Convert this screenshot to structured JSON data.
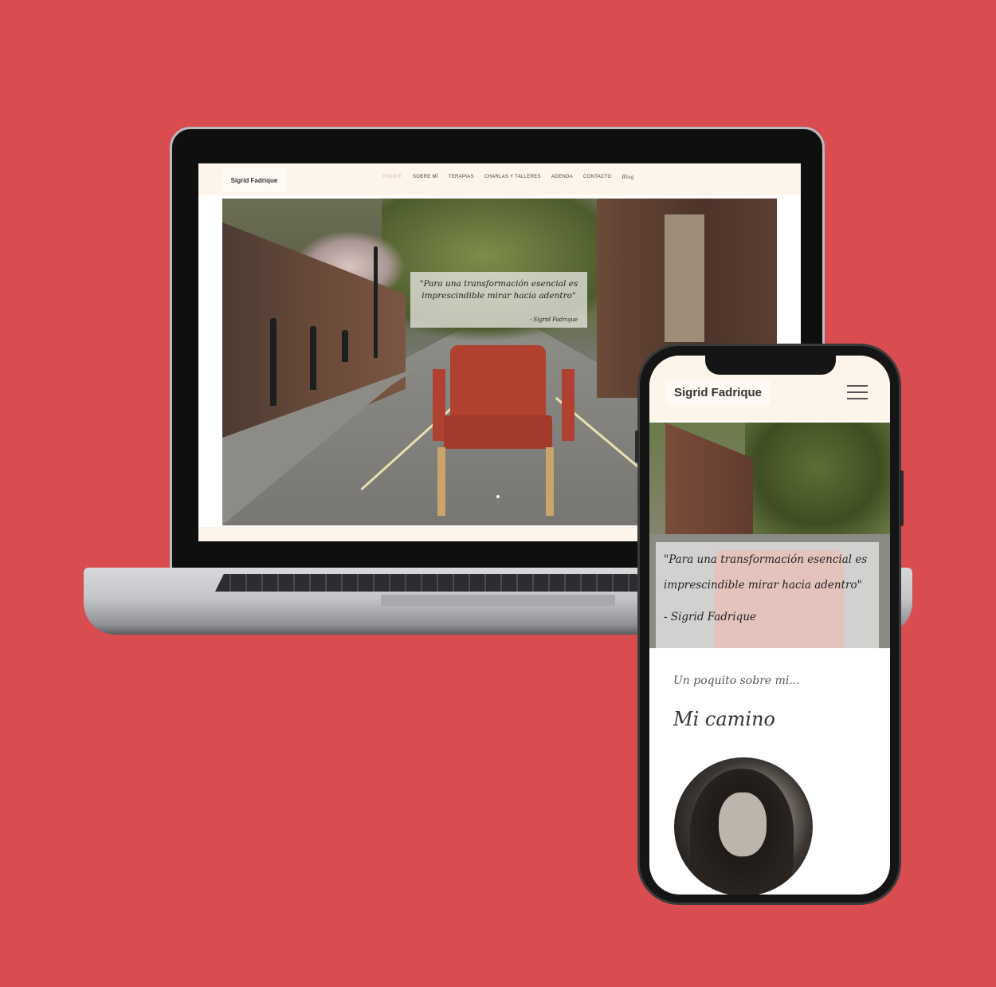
{
  "laptop": {
    "logo": "Sigrid Fadrique",
    "menu": [
      "HOME",
      "SOBRE MÍ",
      "TERAPIAS",
      "CHARLAS Y TALLERES",
      "AGENDA",
      "CONTACTO",
      "Blog"
    ],
    "quote_line1": "\"Para una transformación esencial es",
    "quote_line2": "imprescindible mirar hacia adentro\"",
    "quote_author": "- Sigrid Fadrique"
  },
  "phone": {
    "logo": "Sigrid Fadrique",
    "quote_line1": "\"Para una transformación esencial es",
    "quote_line2": "imprescindible mirar hacia adentro\"",
    "quote_author": "- Sigrid Fadrique",
    "subtitle": "Un poquito sobre mi...",
    "section_title": "Mi camino"
  },
  "colors": {
    "background": "#d94c50",
    "nav_bg": "#fdf4ea",
    "active_menu": "#c9b6a7"
  },
  "icons": [
    "hamburger-menu-icon"
  ]
}
